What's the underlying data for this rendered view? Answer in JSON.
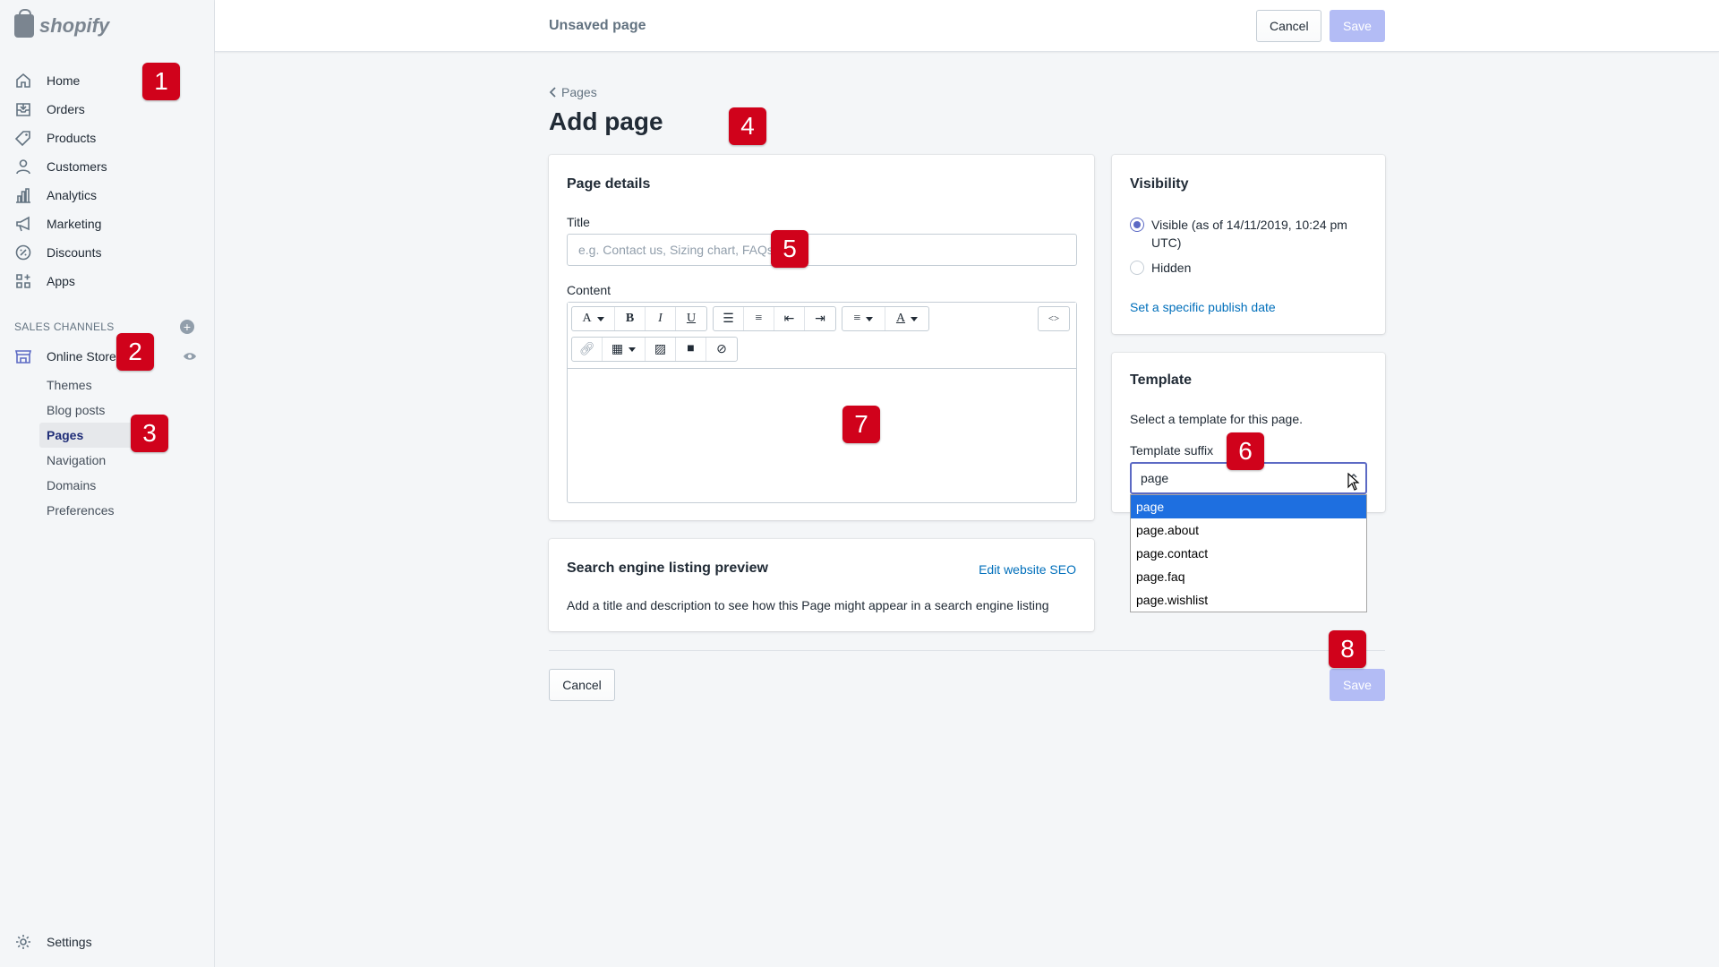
{
  "brand": {
    "name": "shopify"
  },
  "sidebar": {
    "items": [
      {
        "label": "Home",
        "icon": "home-icon"
      },
      {
        "label": "Orders",
        "icon": "orders-icon"
      },
      {
        "label": "Products",
        "icon": "tag-icon"
      },
      {
        "label": "Customers",
        "icon": "person-icon"
      },
      {
        "label": "Analytics",
        "icon": "bar-chart-icon"
      },
      {
        "label": "Marketing",
        "icon": "megaphone-icon"
      },
      {
        "label": "Discounts",
        "icon": "discount-icon"
      },
      {
        "label": "Apps",
        "icon": "apps-icon"
      }
    ],
    "sales_channels_label": "SALES CHANNELS",
    "online_store": "Online Store",
    "subitems": [
      "Themes",
      "Blog posts",
      "Pages",
      "Navigation",
      "Domains",
      "Preferences"
    ],
    "active_subitem": "Pages",
    "settings": "Settings"
  },
  "topbar": {
    "title": "Unsaved page",
    "cancel": "Cancel",
    "save": "Save"
  },
  "breadcrumb": {
    "back": "Pages"
  },
  "page": {
    "title": "Add page"
  },
  "details": {
    "heading": "Page details",
    "title_label": "Title",
    "title_placeholder": "e.g. Contact us, Sizing chart, FAQs",
    "content_label": "Content"
  },
  "seo": {
    "heading": "Search engine listing preview",
    "edit_link": "Edit website SEO",
    "description": "Add a title and description to see how this Page might appear in a search engine listing"
  },
  "visibility": {
    "heading": "Visibility",
    "visible_label": "Visible (as of 14/11/2019, 10:24 pm UTC)",
    "hidden_label": "Hidden",
    "publish_link": "Set a specific publish date"
  },
  "template": {
    "heading": "Template",
    "description": "Select a template for this page.",
    "suffix_label": "Template suffix",
    "selected": "page",
    "options": [
      "page",
      "page.about",
      "page.contact",
      "page.faq",
      "page.wishlist"
    ]
  },
  "footer": {
    "cancel": "Cancel",
    "save": "Save"
  },
  "badges": [
    "1",
    "2",
    "3",
    "4",
    "5",
    "6",
    "7",
    "8"
  ],
  "colors": {
    "accent": "#5c6ac4",
    "primary_disabled": "#b3bcf5",
    "link": "#006fbb",
    "badge": "#d0021b"
  }
}
